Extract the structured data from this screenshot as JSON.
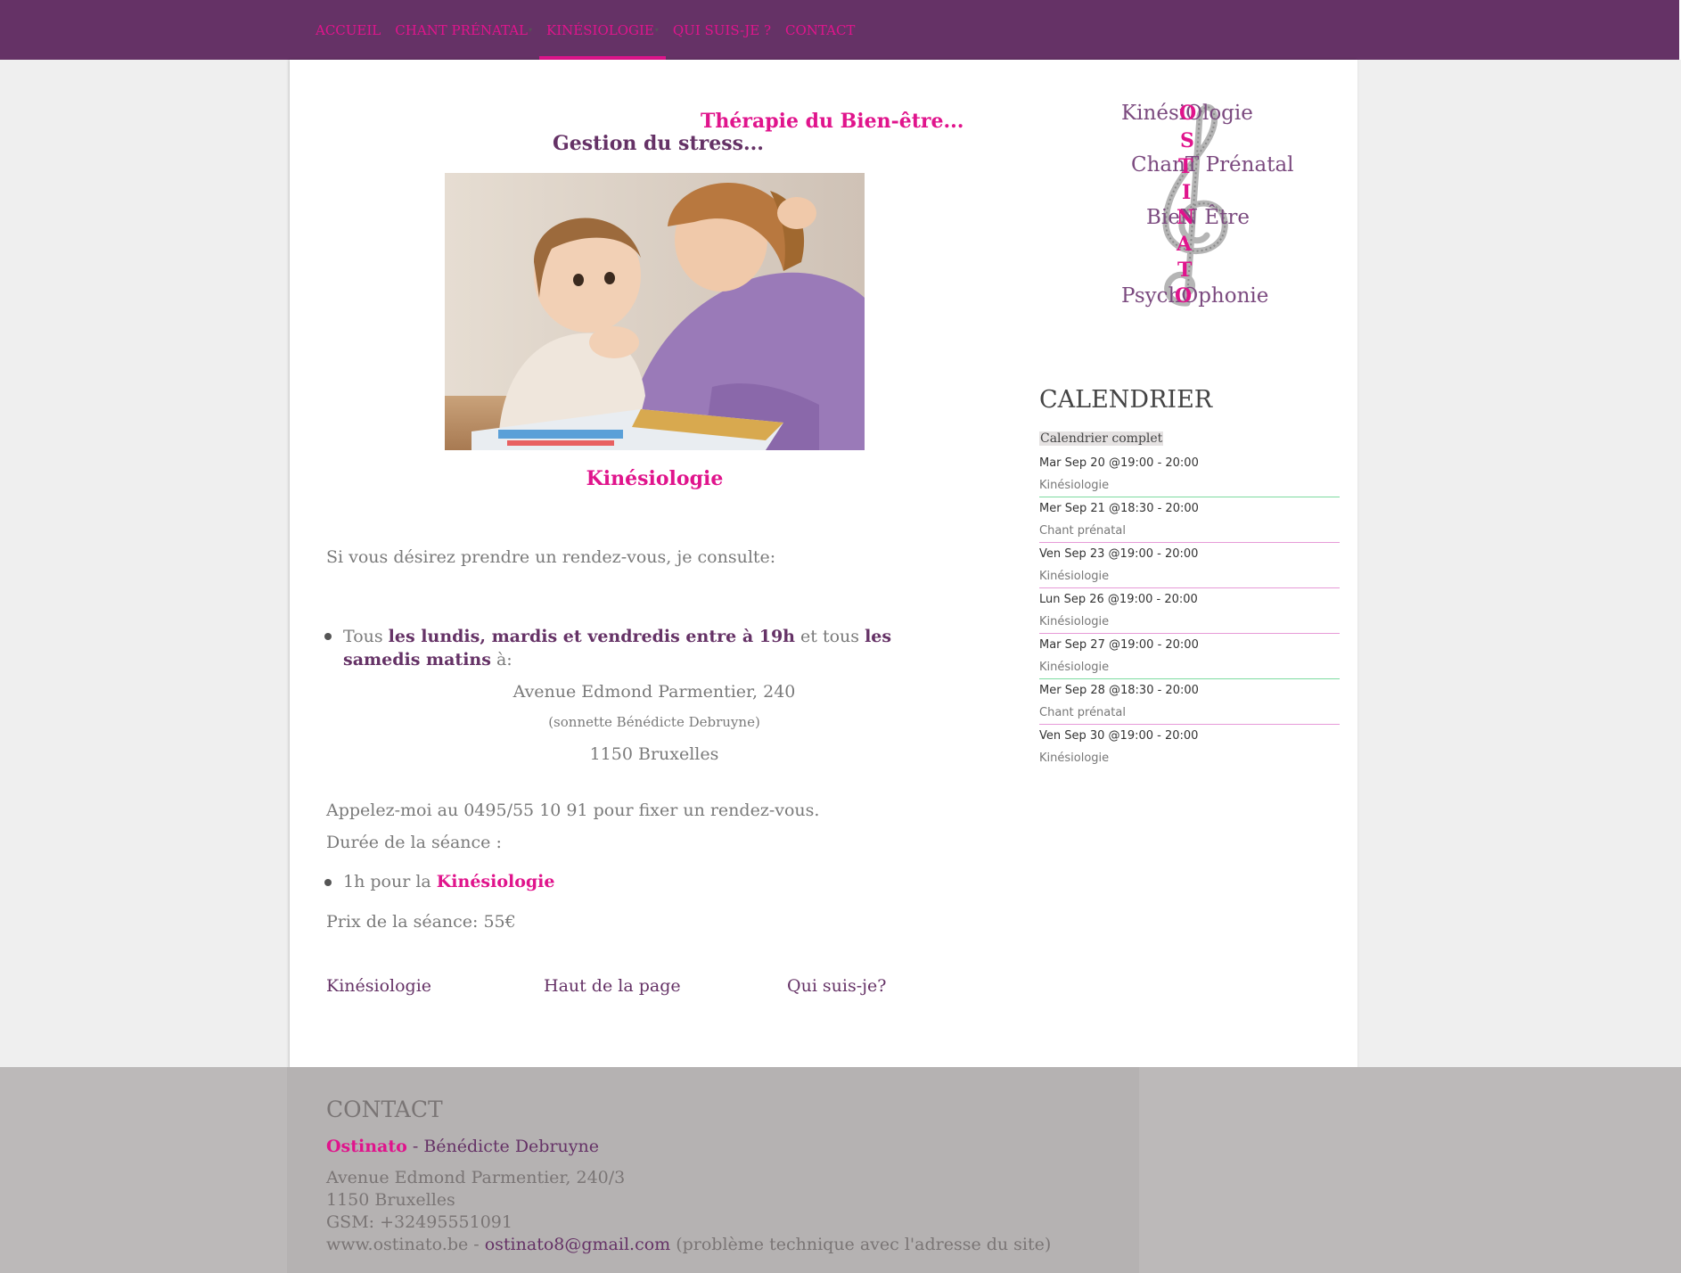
{
  "nav": {
    "items": [
      {
        "label": "ACCUEIL",
        "dropdown": false,
        "active": false
      },
      {
        "label": "CHANT PRÉNATAL",
        "dropdown": true,
        "active": false
      },
      {
        "label": "KINÉSIOLOGIE",
        "dropdown": true,
        "active": true
      },
      {
        "label": "QUI SUIS-JE ?",
        "dropdown": false,
        "active": false
      },
      {
        "label": "CONTACT",
        "dropdown": false,
        "active": false
      }
    ],
    "dropdown_glyph": "▾"
  },
  "main": {
    "slogan_1": "Thérapie du Bien-être...",
    "slogan_2": "Gestion du stress...",
    "hero_image": "mother-and-child-reading-photo",
    "kinesiologie_title": "Kinésiologie",
    "intro": "Si vous désirez prendre un rendez-vous, je consulte:",
    "schedule": {
      "prefix": "Tous ",
      "days": "les lundis, mardis et vendredis entre à 19h",
      "middle": " et tous ",
      "weekend": "les samedis matins",
      "suffix": " à:"
    },
    "address": {
      "street": "Avenue Edmond Parmentier, 240",
      "note": "(sonnette Bénédicte Debruyne)",
      "city": "1150 Bruxelles"
    },
    "call_text": "Appelez-moi au 0495/55 10 91 pour fixer un rendez-vous.",
    "duration_label": "Durée de la séance :",
    "duration_item": {
      "prefix": "1h pour la ",
      "strong": "Kinésiologie"
    },
    "price": "Prix de la séance: 55€",
    "bottom_links": [
      "Kinésiologie",
      "Haut de la page",
      "Qui suis-je?"
    ]
  },
  "logo": {
    "words": [
      "KinésiOlogie",
      "ChanT Prénatal",
      "BieN Être",
      "PsychOphonie"
    ],
    "vertical_letters": [
      "O",
      "S",
      "T",
      "I",
      "N",
      "A",
      "T",
      "O"
    ]
  },
  "calendar": {
    "title": "CALENDRIER",
    "complete_link": "Calendrier complet",
    "events": [
      {
        "date": "Mar Sep 20 @19:00 - 20:00",
        "category": "Kinésiologie",
        "separator_color": "#7ddba0"
      },
      {
        "date": "Mer Sep 21 @18:30 - 20:00",
        "category": "Chant prénatal",
        "separator_color": "#e79ad8"
      },
      {
        "date": "Ven Sep 23 @19:00 - 20:00",
        "category": "Kinésiologie",
        "separator_color": "#e79ad8"
      },
      {
        "date": "Lun Sep 26 @19:00 - 20:00",
        "category": "Kinésiologie",
        "separator_color": "#e79ad8"
      },
      {
        "date": "Mar Sep 27 @19:00 - 20:00",
        "category": "Kinésiologie",
        "separator_color": "#7ddba0"
      },
      {
        "date": "Mer Sep 28 @18:30 - 20:00",
        "category": "Chant prénatal",
        "separator_color": "#e79ad8"
      },
      {
        "date": "Ven Sep 30 @19:00 - 20:00",
        "category": "Kinésiologie",
        "separator_color": ""
      }
    ]
  },
  "footer": {
    "title": "CONTACT",
    "brand": "Ostinato",
    "brand_rest": " - Bénédicte Debruyne",
    "address_line": "Avenue Edmond Parmentier, 240/3",
    "city": "1150 Bruxelles",
    "gsm": "GSM: +32495551091",
    "web_prefix": " www.ostinato.be - ",
    "email": "ostinato8@gmail.com",
    "web_suffix": " (problème technique avec l'adresse du site)"
  },
  "colors": {
    "nav_bg": "#653266",
    "accent_pink": "#e0148c",
    "accent_purple": "#653266",
    "footer_bg": "#bcb9b9"
  }
}
